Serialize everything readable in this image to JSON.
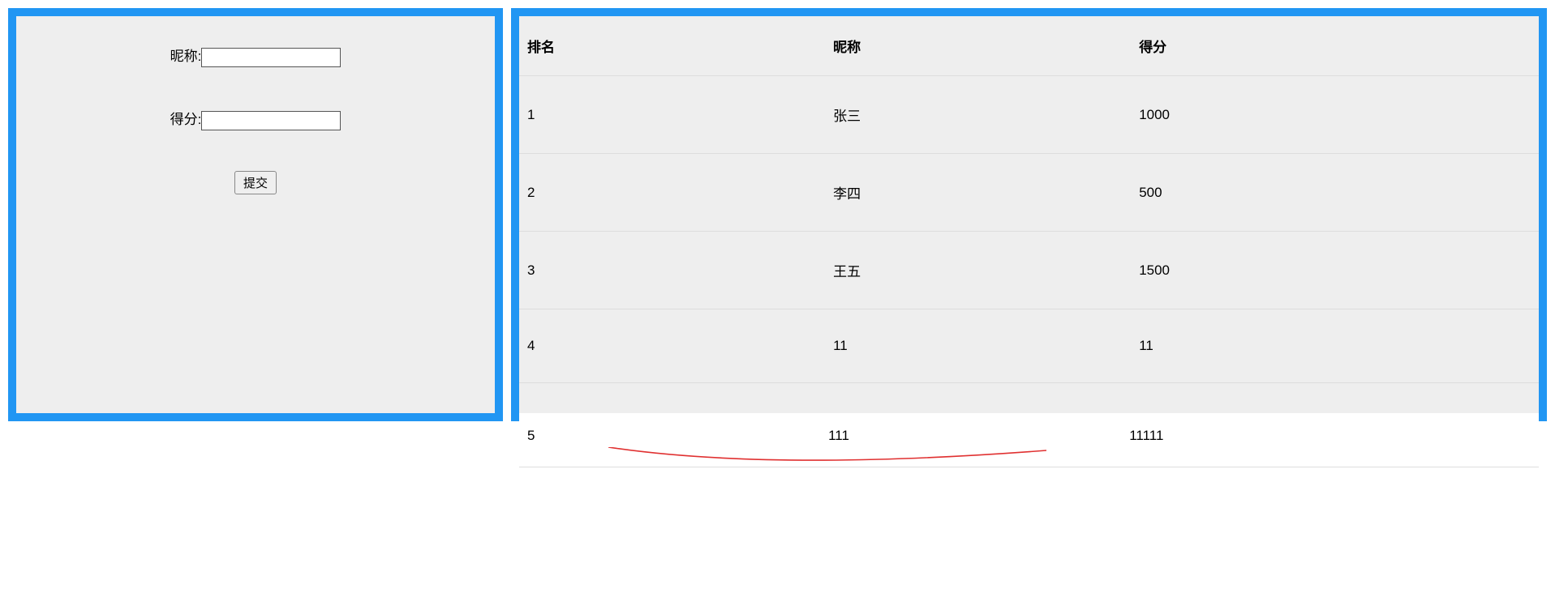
{
  "form": {
    "nickname_label": "昵称:",
    "nickname_value": "",
    "score_label": "得分:",
    "score_value": "",
    "submit_label": "提交"
  },
  "table": {
    "headers": {
      "rank": "排名",
      "nickname": "昵称",
      "score": "得分"
    },
    "rows": [
      {
        "rank": "1",
        "nickname": "张三",
        "score": "1000"
      },
      {
        "rank": "2",
        "nickname": "李四",
        "score": "500"
      },
      {
        "rank": "3",
        "nickname": "王五",
        "score": "1500"
      },
      {
        "rank": "4",
        "nickname": "11",
        "score": "11"
      }
    ],
    "overflow_row": {
      "rank": "5",
      "nickname": "111",
      "score": "11111"
    }
  }
}
